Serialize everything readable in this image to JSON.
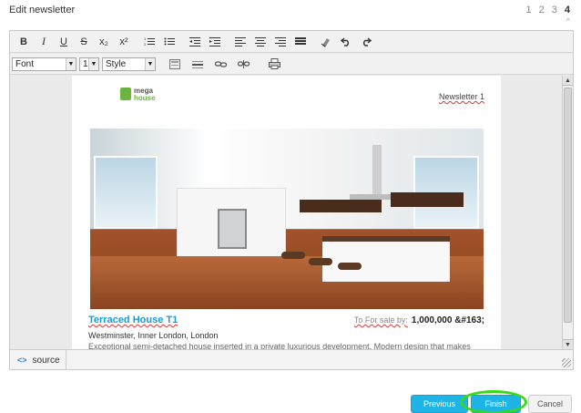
{
  "header": {
    "title": "Edit newsletter",
    "steps": [
      "1",
      "2",
      "3",
      "4"
    ],
    "active_step": "4",
    "collapse_glyph": "^"
  },
  "toolbar": {
    "bold": "B",
    "italic": "I",
    "underline": "U",
    "strike": "S",
    "subscript": "x₂",
    "superscript": "x²",
    "font_select": "Font",
    "size_select": "1",
    "style_select": "Style"
  },
  "document": {
    "logo_top": "mega",
    "logo_bottom": "house",
    "newsletter_label": "Newsletter 1",
    "property_title": "Terraced House T1",
    "price_label": "To For sale by:",
    "price_value": "1,000,000 &#163;",
    "location": "Westminster, Inner London, London",
    "description": "Exceptional semi-detached house inserted in a private luxurious development. Modern design that makes"
  },
  "statusbar": {
    "source_icon": "<>",
    "source_label": "source"
  },
  "footer": {
    "previous_label": "Previous",
    "finish_label": "Finish",
    "cancel_label": "Cancel"
  },
  "colors": {
    "accent": "#1eb4e6",
    "highlight_ring": "#3ad81a",
    "title_link": "#1a9bd6",
    "logo_green": "#6cb33f"
  }
}
